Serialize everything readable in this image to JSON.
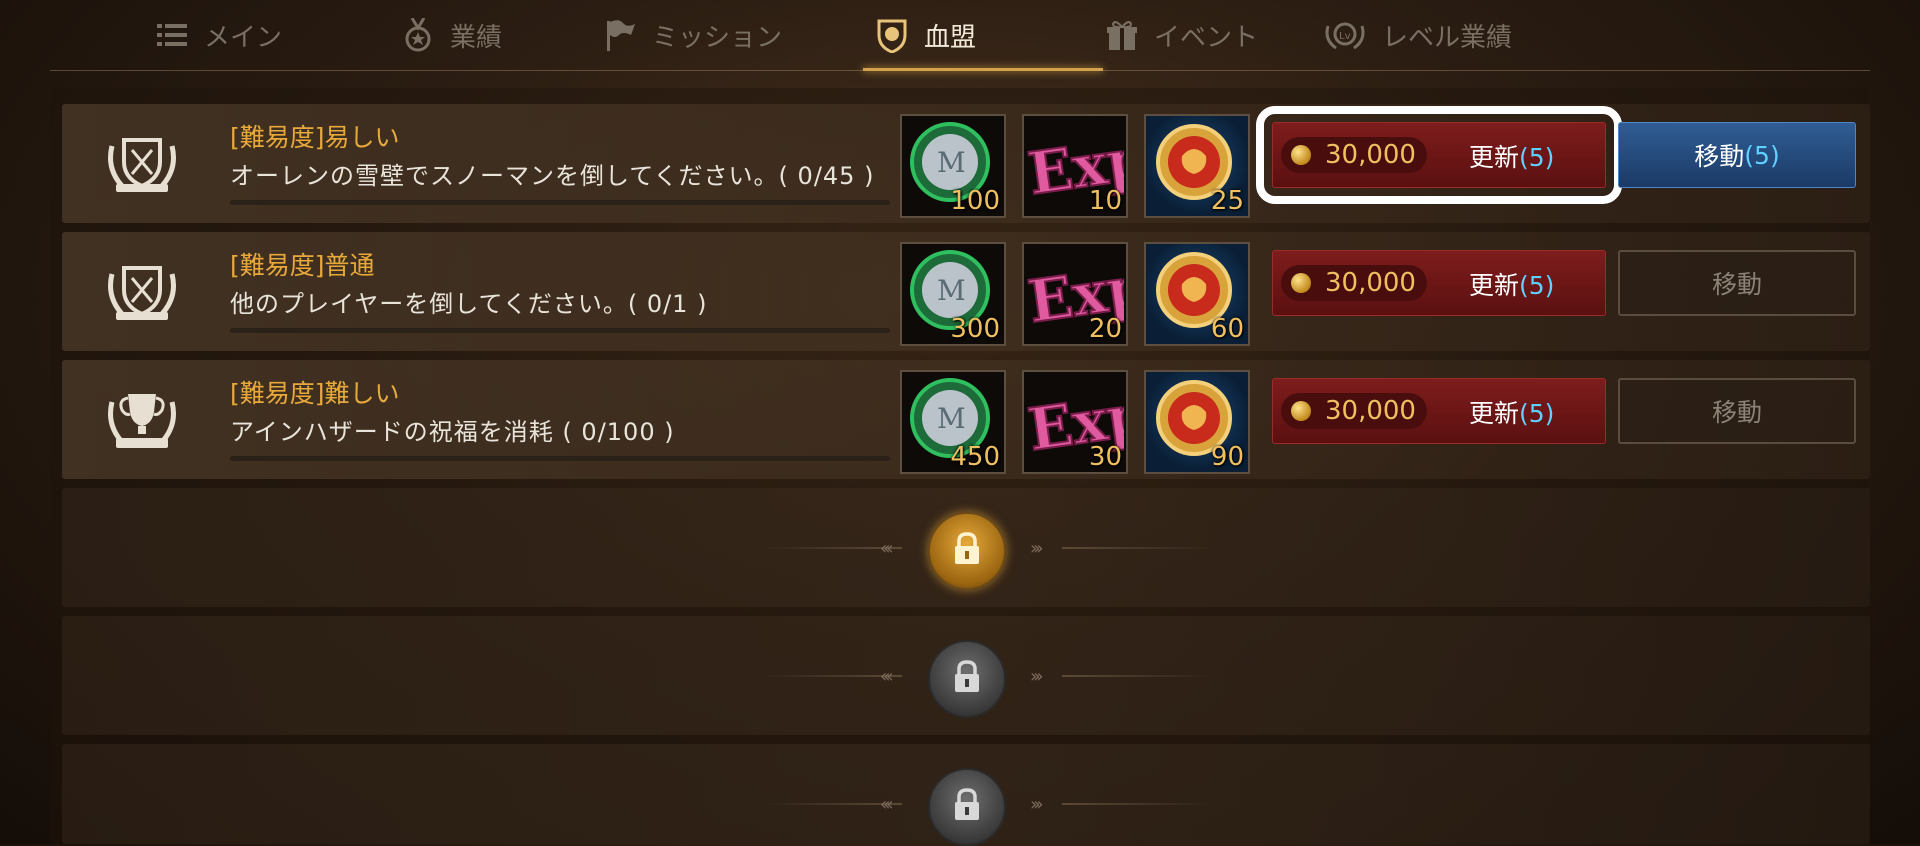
{
  "tabs": [
    {
      "label": "メイン",
      "icon": "list-icon"
    },
    {
      "label": "業績",
      "icon": "medal-icon"
    },
    {
      "label": "ミッション",
      "icon": "flag-icon"
    },
    {
      "label": "血盟",
      "icon": "clan-shield-icon"
    },
    {
      "label": "イベント",
      "icon": "gift-icon"
    },
    {
      "label": "レベル業績",
      "icon": "level-laurel-icon"
    }
  ],
  "active_tab": "血盟",
  "missions": [
    {
      "title": "[難易度]易しい",
      "description": "オーレンの雪壁でスノーマンを倒してください。( 0/45 )",
      "rewards": [
        {
          "type": "adena-coin",
          "qty": "100"
        },
        {
          "type": "exp",
          "qty": "10"
        },
        {
          "type": "clan-lion-coin",
          "qty": "25"
        }
      ],
      "refresh_cost": "30,000",
      "refresh_label": "更新",
      "refresh_count": "(5)",
      "move_label": "移動",
      "move_count": "(5)"
    },
    {
      "title": "[難易度]普通",
      "description": "他のプレイヤーを倒してください。( 0/1 )",
      "rewards": [
        {
          "type": "adena-coin",
          "qty": "300"
        },
        {
          "type": "exp",
          "qty": "20"
        },
        {
          "type": "clan-lion-coin",
          "qty": "60"
        }
      ],
      "refresh_cost": "30,000",
      "refresh_label": "更新",
      "refresh_count": "(5)",
      "move_label": "移動",
      "move_count": ""
    },
    {
      "title": "[難易度]難しい",
      "description": "アインハザードの祝福を消耗 ( 0/100 )",
      "rewards": [
        {
          "type": "adena-coin",
          "qty": "450"
        },
        {
          "type": "exp",
          "qty": "30"
        },
        {
          "type": "clan-lion-coin",
          "qty": "90"
        }
      ],
      "refresh_cost": "30,000",
      "refresh_label": "更新",
      "refresh_count": "(5)",
      "move_label": "移動",
      "move_count": ""
    }
  ],
  "locked_slots": [
    {
      "state": "unlockable",
      "color": "#d89a2a"
    },
    {
      "state": "locked",
      "color": "#555555"
    },
    {
      "state": "locked",
      "color": "#555555"
    }
  ],
  "colors": {
    "difficulty_title": "#e8a93b",
    "refresh_button": "#6e1616",
    "move_button_active": "#24497c",
    "count_highlight": "#5fd0ff",
    "tab_active_underline": "#d4a24a"
  }
}
